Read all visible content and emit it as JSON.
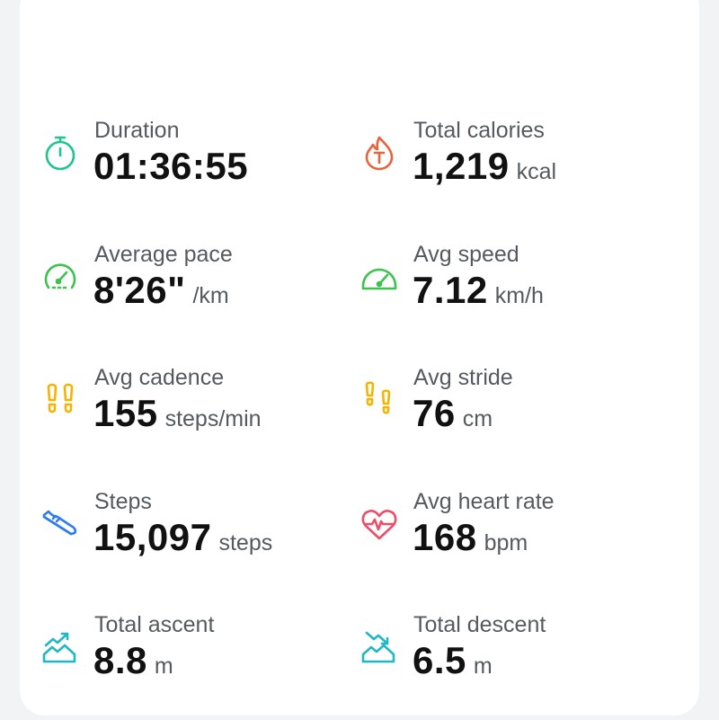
{
  "metrics": [
    {
      "label": "Duration",
      "value": "01:36:55",
      "unit": "",
      "icon": "stopwatch-icon",
      "color": "#1fc58e"
    },
    {
      "label": "Total calories",
      "value": "1,219",
      "unit": "kcal",
      "icon": "calories-flame-icon",
      "color": "#e8623c"
    },
    {
      "label": "Average pace",
      "value": "8'26\"",
      "unit": "/km",
      "icon": "pace-gauge-icon",
      "color": "#3cc24f"
    },
    {
      "label": "Avg speed",
      "value": "7.12",
      "unit": "km/h",
      "icon": "speedometer-icon",
      "color": "#3cc24f"
    },
    {
      "label": "Avg cadence",
      "value": "155",
      "unit": "steps/min",
      "icon": "footprints-icon",
      "color": "#f5b400"
    },
    {
      "label": "Avg stride",
      "value": "76",
      "unit": "cm",
      "icon": "stride-footprints-icon",
      "color": "#f5b400"
    },
    {
      "label": "Steps",
      "value": "15,097",
      "unit": "steps",
      "icon": "shoe-icon",
      "color": "#2f7bf0"
    },
    {
      "label": "Avg heart rate",
      "value": "168",
      "unit": "bpm",
      "icon": "heart-rate-icon",
      "color": "#ee4d6a"
    },
    {
      "label": "Total ascent",
      "value": "8.8",
      "unit": "m",
      "icon": "ascent-mountain-icon",
      "color": "#1fb8c4"
    },
    {
      "label": "Total descent",
      "value": "6.5",
      "unit": "m",
      "icon": "descent-mountain-icon",
      "color": "#1fb8c4"
    }
  ]
}
